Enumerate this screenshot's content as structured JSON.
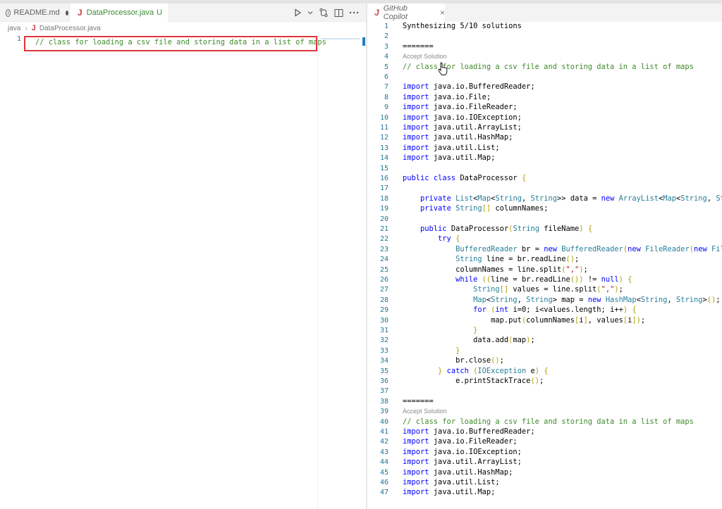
{
  "tabs": [
    {
      "label": "README.md",
      "modified": true
    },
    {
      "label": "DataProcessor.java",
      "status": "U",
      "modified": true
    }
  ],
  "breadcrumb": [
    "java",
    "DataProcessor.java"
  ],
  "editor": {
    "line_number": "1",
    "line_text": "// class for loading a csv file and storing data in a list of maps"
  },
  "copilot": {
    "tab_label": "GitHub Copilot",
    "accept_label": "Accept Solution",
    "lines": [
      {
        "n": "1",
        "t": "Synthesizing 5/10 solutions"
      },
      {
        "n": "2",
        "t": ""
      },
      {
        "n": "3",
        "t": "======="
      },
      {
        "n": "4",
        "t": ""
      },
      {
        "n": "5",
        "t": "// class for loading a csv file and storing data in a list of maps"
      },
      {
        "n": "6",
        "t": ""
      },
      {
        "n": "7",
        "t": "import java.io.BufferedReader;"
      },
      {
        "n": "8",
        "t": "import java.io.File;"
      },
      {
        "n": "9",
        "t": "import java.io.FileReader;"
      },
      {
        "n": "10",
        "t": "import java.io.IOException;"
      },
      {
        "n": "11",
        "t": "import java.util.ArrayList;"
      },
      {
        "n": "12",
        "t": "import java.util.HashMap;"
      },
      {
        "n": "13",
        "t": "import java.util.List;"
      },
      {
        "n": "14",
        "t": "import java.util.Map;"
      },
      {
        "n": "15",
        "t": ""
      },
      {
        "n": "16",
        "t": "public class DataProcessor {"
      },
      {
        "n": "17",
        "t": ""
      },
      {
        "n": "18",
        "t": "    private List<Map<String, String>> data = new ArrayList<Map<String, String>"
      },
      {
        "n": "19",
        "t": "    private String[] columnNames;"
      },
      {
        "n": "20",
        "t": ""
      },
      {
        "n": "21",
        "t": "    public DataProcessor(String fileName) {"
      },
      {
        "n": "22",
        "t": "        try {"
      },
      {
        "n": "23",
        "t": "            BufferedReader br = new BufferedReader(new FileReader(new File(fil"
      },
      {
        "n": "24",
        "t": "            String line = br.readLine();"
      },
      {
        "n": "25",
        "t": "            columnNames = line.split(\",\");"
      },
      {
        "n": "26",
        "t": "            while ((line = br.readLine()) != null) {"
      },
      {
        "n": "27",
        "t": "                String[] values = line.split(\",\");"
      },
      {
        "n": "28",
        "t": "                Map<String, String> map = new HashMap<String, String>();"
      },
      {
        "n": "29",
        "t": "                for (int i=0; i<values.length; i++) {"
      },
      {
        "n": "30",
        "t": "                    map.put(columnNames[i], values[i]);"
      },
      {
        "n": "31",
        "t": "                }"
      },
      {
        "n": "32",
        "t": "                data.add(map);"
      },
      {
        "n": "33",
        "t": "            }"
      },
      {
        "n": "34",
        "t": "            br.close();"
      },
      {
        "n": "35",
        "t": "        } catch (IOException e) {"
      },
      {
        "n": "36",
        "t": "            e.printStackTrace();"
      },
      {
        "n": "37",
        "t": ""
      },
      {
        "n": "38",
        "t": "======="
      },
      {
        "n": "39",
        "t": ""
      },
      {
        "n": "40",
        "t": "// class for loading a csv file and storing data in a list of maps"
      },
      {
        "n": "41",
        "t": "import java.io.BufferedReader;"
      },
      {
        "n": "42",
        "t": "import java.io.FileReader;"
      },
      {
        "n": "43",
        "t": "import java.io.IOException;"
      },
      {
        "n": "44",
        "t": "import java.util.ArrayList;"
      },
      {
        "n": "45",
        "t": "import java.util.HashMap;"
      },
      {
        "n": "46",
        "t": "import java.util.List;"
      },
      {
        "n": "47",
        "t": "import java.util.Map;"
      }
    ]
  }
}
